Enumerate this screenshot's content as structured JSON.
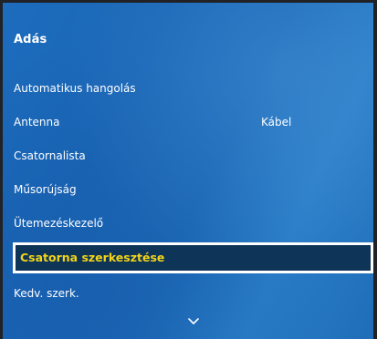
{
  "panel": {
    "title": "Adás"
  },
  "menu": {
    "items": [
      {
        "label": "Automatikus hangolás",
        "value": ""
      },
      {
        "label": "Antenna",
        "value": "Kábel"
      },
      {
        "label": "Csatornalista",
        "value": ""
      },
      {
        "label": "Műsorújság",
        "value": ""
      },
      {
        "label": "Ütemezéskezelő",
        "value": ""
      },
      {
        "label": "Csatorna szerkesztése",
        "value": "",
        "selected": true
      },
      {
        "label": "Kedv. szerk.",
        "value": ""
      }
    ]
  },
  "icons": {
    "scroll_down": "chevron-down-icon"
  },
  "colors": {
    "panel_blue": "#1d6cbd",
    "selected_bg": "#0e3458",
    "selected_text": "#f2d418",
    "focus_border": "#ffffff"
  }
}
